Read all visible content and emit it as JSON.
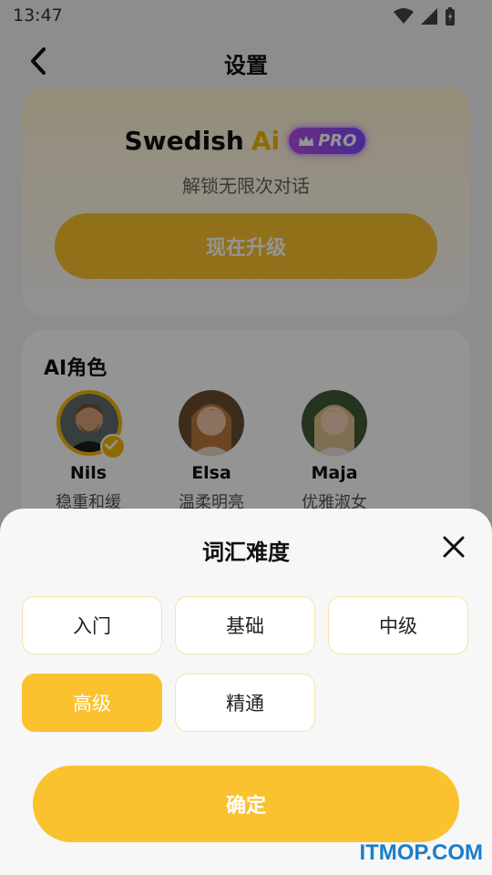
{
  "status_bar": {
    "time": "13:47"
  },
  "header": {
    "title": "设置"
  },
  "pro_card": {
    "brand_name": "Swedish",
    "brand_ai": "Ai",
    "pro_badge": "PRO",
    "subtitle": "解锁无限次对话",
    "upgrade_label": "现在升级"
  },
  "roles": {
    "title": "AI角色",
    "items": [
      {
        "name": "Nils",
        "desc": "稳重和缓",
        "selected": true
      },
      {
        "name": "Elsa",
        "desc": "温柔明亮",
        "selected": false
      },
      {
        "name": "Maja",
        "desc": "优雅淑女",
        "selected": false
      }
    ]
  },
  "sheet": {
    "title": "词汇难度",
    "options": [
      "入门",
      "基础",
      "中级",
      "高级",
      "精通"
    ],
    "selected": "高级",
    "confirm_label": "确定"
  },
  "watermark": "ITMOP.COM",
  "colors": {
    "accent": "#fbc22f",
    "pro": "#9b4dff"
  }
}
